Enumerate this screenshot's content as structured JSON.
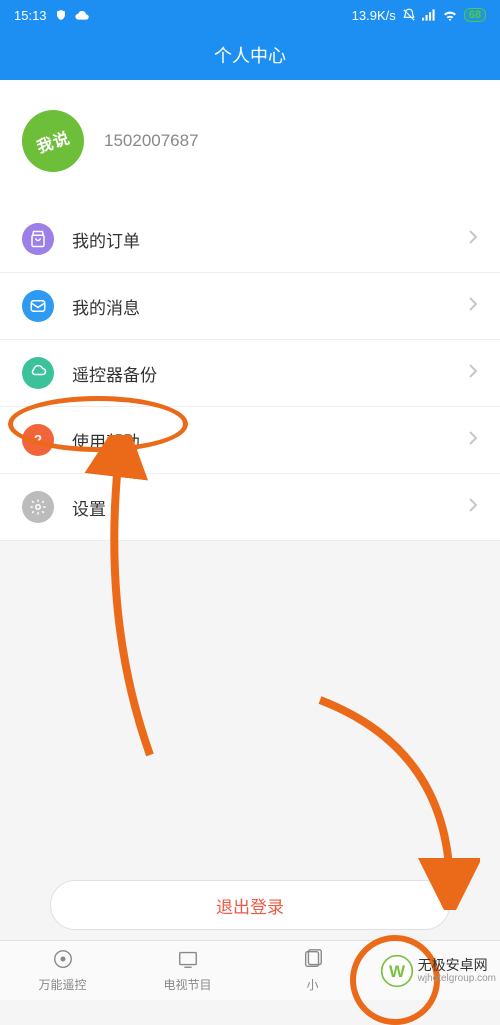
{
  "status_bar": {
    "time": "15:13",
    "speed": "13.9K/s",
    "battery": "68"
  },
  "header": {
    "title": "个人中心"
  },
  "profile": {
    "avatar_text": "我说",
    "user_id": "1502007687"
  },
  "menu": [
    {
      "icon": "orders",
      "icon_bg": "#9c7fe8",
      "label": "我的订单"
    },
    {
      "icon": "message",
      "icon_bg": "#2e9af2",
      "label": "我的消息"
    },
    {
      "icon": "cloud",
      "icon_bg": "#3bc29b",
      "label": "遥控器备份"
    },
    {
      "icon": "help",
      "icon_bg": "#f2643a",
      "label": "使用帮助"
    },
    {
      "icon": "settings",
      "icon_bg": "#bcbcbc",
      "label": "设置"
    }
  ],
  "logout": {
    "label": "退出登录"
  },
  "tabs": [
    {
      "label": "万能遥控"
    },
    {
      "label": "电视节目"
    },
    {
      "label": "小"
    },
    {
      "label": ""
    }
  ],
  "watermark": {
    "cn": "无极安卓网",
    "en": "wjhotelgroup.com"
  },
  "icons": {
    "orders_svg": "bag",
    "message_svg": "mail",
    "cloud_svg": "cloud",
    "help_svg": "question",
    "settings_svg": "gear"
  },
  "colors": {
    "accent": "#1e8ff2",
    "annotation": "#eb6a1a",
    "logout_text": "#ec5b45"
  }
}
